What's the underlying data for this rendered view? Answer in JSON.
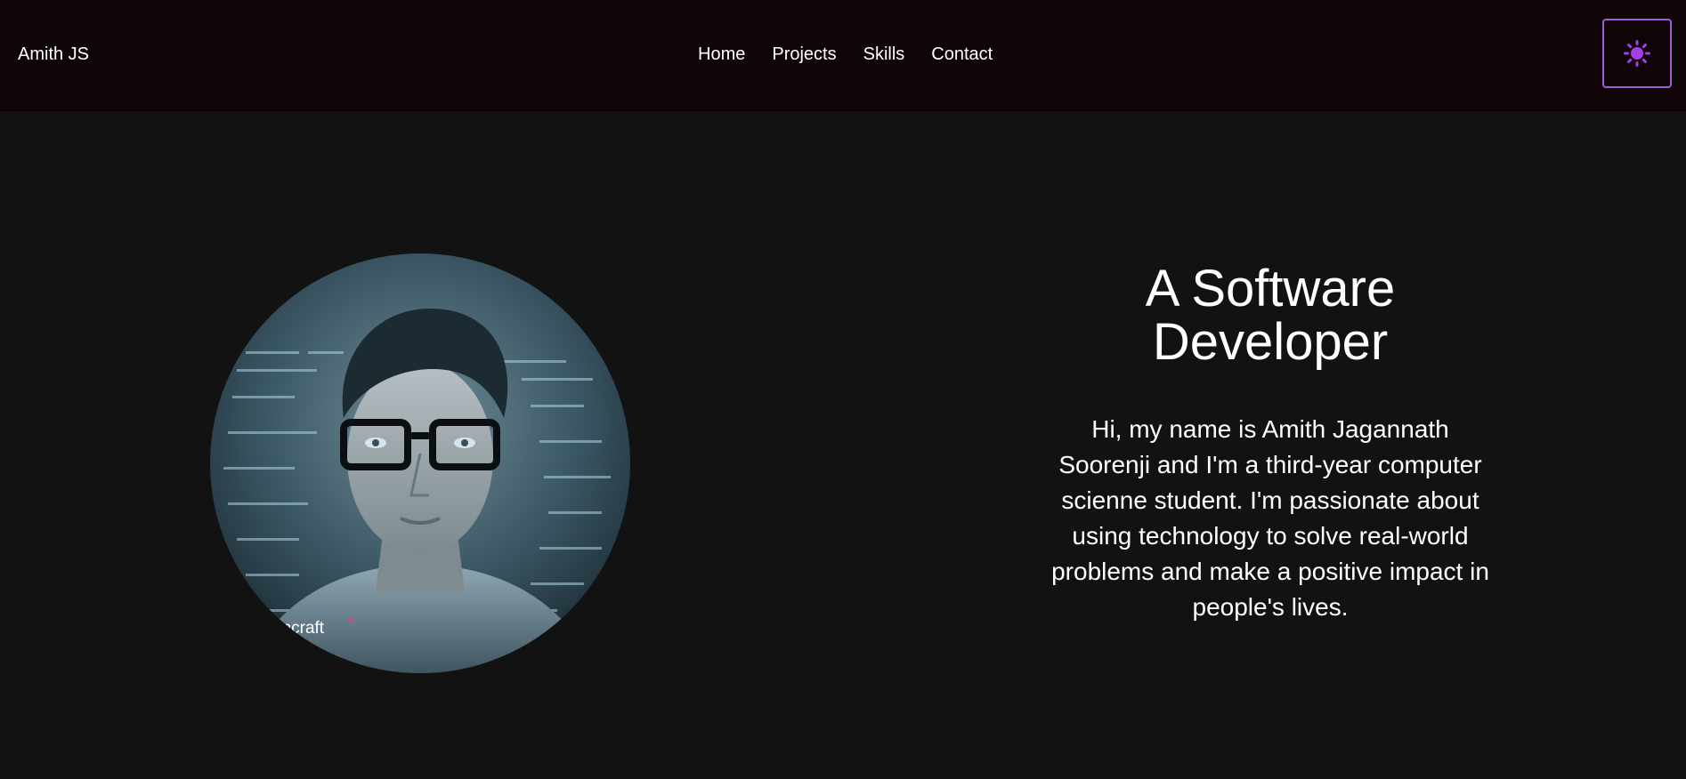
{
  "navbar": {
    "brand": "Amith JS",
    "links": [
      {
        "label": "Home"
      },
      {
        "label": "Projects"
      },
      {
        "label": "Skills"
      },
      {
        "label": "Contact"
      }
    ],
    "theme_toggle": {
      "icon": "sun-icon",
      "color": "#a33fe6",
      "border_color": "#a05ad8"
    }
  },
  "hero": {
    "avatar": {
      "icon": "profile-photo",
      "watermark": "encraft"
    },
    "headline": "A Software Developer",
    "bio": "Hi, my name is Amith Jagannath Soorenji and I'm a third-year computer scienne student. I'm passionate about using technology to solve real-world problems and make a positive impact in people's lives."
  },
  "colors": {
    "navbar_bg": "#0f0507",
    "page_bg": "#121212",
    "text": "#ffffff",
    "accent": "#a33fe6"
  }
}
